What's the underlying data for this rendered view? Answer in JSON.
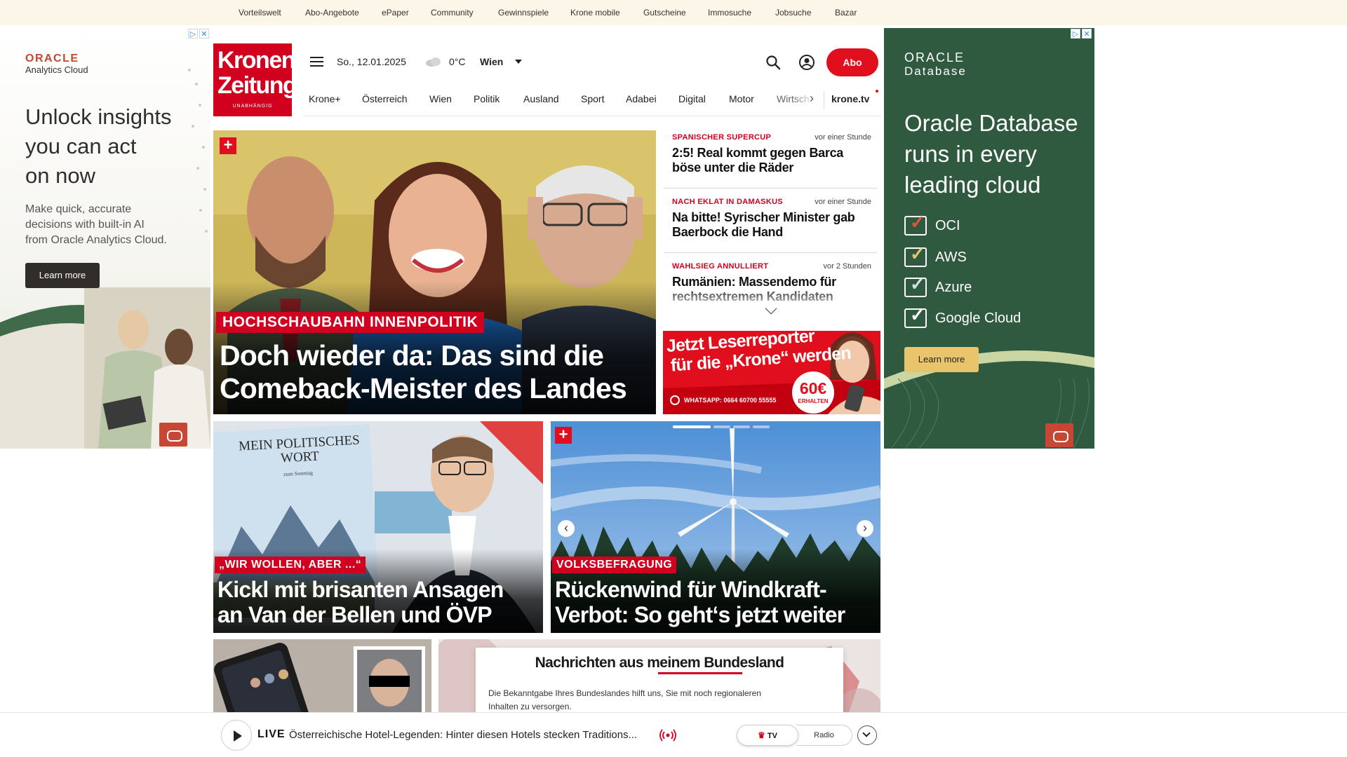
{
  "topbar": {
    "links": [
      "Vorteilswelt",
      "Abo-Angebote",
      "ePaper",
      "Community",
      "Gewinnspiele",
      "Krone mobile",
      "Gutscheine",
      "Immosuche",
      "Jobsuche",
      "Bazar"
    ]
  },
  "ad_left": {
    "brand": "ORACLE",
    "product": "Analytics Cloud",
    "headline_lines": [
      "Unlock insights",
      "you can act",
      "on now"
    ],
    "body_lines": [
      "Make quick, accurate",
      "decisions with built-in AI",
      "from Oracle Analytics Cloud."
    ],
    "cta": "Learn more"
  },
  "ad_right": {
    "brand": "ORACLE",
    "product": "Database",
    "headline_lines": [
      "Oracle Database",
      "runs in every",
      "leading cloud"
    ],
    "checklist": [
      "OCI",
      "AWS",
      "Azure",
      "Google Cloud"
    ],
    "cta": "Learn more"
  },
  "logo": {
    "line1": "Kronen",
    "line2": "Zeitung",
    "tagline": "UNABHÄNGIG"
  },
  "header": {
    "date": "So., 12.01.2025",
    "temperature": "0°C",
    "location": "Wien",
    "abo_label": "Abo"
  },
  "nav": {
    "items": [
      "Krone+",
      "Österreich",
      "Wien",
      "Politik",
      "Ausland",
      "Sport",
      "Adabei",
      "Digital",
      "Motor",
      "Wirtsch"
    ],
    "tv_link": "krone.tv"
  },
  "hero": {
    "kicker": "HOCHSCHAUBAHN INNENPOLITIK",
    "headline_lines": [
      "Doch wieder da: Das sind die",
      "Comeback-Meister des Landes"
    ]
  },
  "ticker": [
    {
      "kicker": "SPANISCHER SUPERCUP",
      "time": "vor einer Stunde",
      "title": "2:5! Real kommt gegen Barca böse unter die Räder"
    },
    {
      "kicker": "NACH EKLAT IN DAMASKUS",
      "time": "vor einer Stunde",
      "title": "Na bitte! Syrischer Minister gab Baerbock die Hand"
    },
    {
      "kicker": "WAHLSIEG ANNULLIERT",
      "time": "vor 2 Stunden",
      "title": "Rumänien: Massendemo für rechtsextremen Kandidaten"
    }
  ],
  "reporter_banner": {
    "line1": "Jetzt Leserreporter",
    "line2": "für die „Krone“ werden",
    "whatsapp": "WHATSAPP: 0664 60700 55555",
    "amount": "60€",
    "amount_sub": "ERHALTEN"
  },
  "stories": [
    {
      "kicker": "„WIR WOLLEN, ABER ...“",
      "headline_lines": [
        "Kickl mit brisanten Ansagen",
        "an Van der Bellen und ÖVP"
      ],
      "book_title": "MEIN POLITISCHES WORT",
      "book_sub": "zum Sonntag"
    },
    {
      "kicker": "VOLKSBEFRAGUNG",
      "headline_lines": [
        "Rückenwind für Windkraft-",
        "Verbot: So geht‘s jetzt weiter"
      ]
    }
  ],
  "bundesland": {
    "title": "Nachrichten aus meinem Bundesland",
    "body_lines": [
      "Die Bekanntgabe Ihres Bundeslandes hilft uns, Sie mit noch regionaleren",
      "Inhalten zu versorgen."
    ]
  },
  "live": {
    "label": "LIVE",
    "title": "Österreichische Hotel-Legenden: Hinter diesen Hotels stecken Traditions...",
    "tv": "TV",
    "radio": "Radio"
  },
  "colors": {
    "brand_red": "#d1001f",
    "abo_red": "#e10f1e",
    "oracle_red": "#c74634",
    "oracle_green": "#2f5a3f"
  }
}
